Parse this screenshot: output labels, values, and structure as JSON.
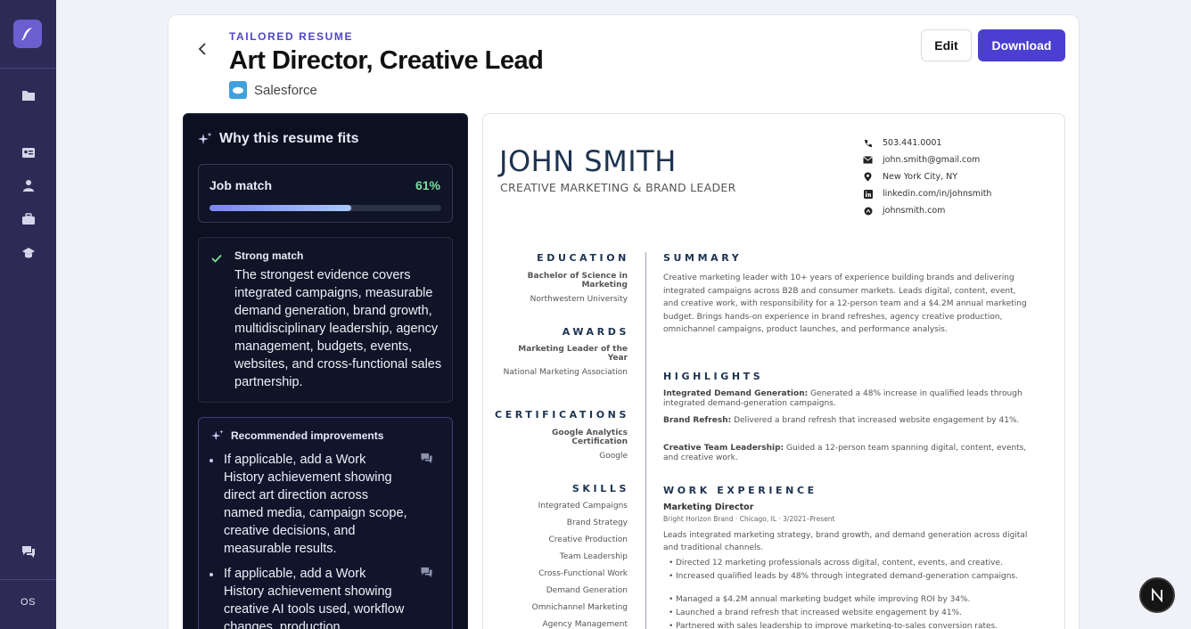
{
  "sidebar": {
    "footer_label": "OS"
  },
  "header": {
    "eyebrow": "TAILORED RESUME",
    "title": "Art Director, Creative Lead",
    "company": "Salesforce",
    "edit_label": "Edit",
    "download_label": "Download"
  },
  "fit": {
    "title": "Why this resume fits",
    "match_label": "Job match",
    "match_pct": "61%",
    "match_value": 0.61,
    "strong_head": "Strong match",
    "strong_body": "The strongest evidence covers integrated campaigns, measurable demand generation, brand growth, multidisciplinary leadership, agency management, budgets, events, websites, and cross-functional sales partnership.",
    "rec_head": "Recommended improvements",
    "recommendations": [
      "If applicable, add a Work History achievement showing direct art direction across named media, campaign scope, creative decisions, and measurable results.",
      "If applicable, add a Work History achievement showing creative AI tools used, workflow changes, production"
    ]
  },
  "resume": {
    "name": "JOHN SMITH",
    "role": "CREATIVE MARKETING & BRAND LEADER",
    "contact": {
      "phone": "503.441.0001",
      "email": "john.smith@gmail.com",
      "location": "New York City, NY",
      "linkedin": "linkedin.com/in/johnsmith",
      "website": "johnsmith.com"
    },
    "education_head": "EDUCATION",
    "degree": "Bachelor of Science in Marketing",
    "school": "Northwestern University",
    "awards_head": "AWARDS",
    "award": "Marketing Leader of the Year",
    "award_org": "National Marketing Association",
    "cert_head": "CERTIFICATIONS",
    "cert": "Google Analytics Certification",
    "cert_org": "Google",
    "skills_head": "SKILLS",
    "skills": [
      "Integrated Campaigns",
      "Brand Strategy",
      "Creative Production",
      "Team Leadership",
      "Cross-Functional Work",
      "Demand Generation",
      "Omnichannel Marketing",
      "Agency Management"
    ],
    "summary_head": "SUMMARY",
    "summary": "Creative marketing leader with 10+ years of experience building brands and delivering integrated campaigns across B2B and consumer markets. Leads digital, content, event, and creative work, with responsibility for a 12-person team and a $4.2M annual marketing budget. Brings hands-on experience in brand refreshes, agency creative production, omnichannel campaigns, product launches, and performance analysis.",
    "highlights_head": "HIGHLIGHTS",
    "highlights": [
      {
        "label": "Integrated Demand Generation:",
        "text": " Generated a 48% increase in qualified leads through integrated demand-generation campaigns."
      },
      {
        "label": "Brand Refresh:",
        "text": " Delivered a brand refresh that increased website engagement by 41%."
      },
      {
        "label": "Creative Team Leadership:",
        "text": " Guided a 12-person team spanning digital, content, events, and creative work."
      }
    ],
    "work_head": "WORK EXPERIENCE",
    "job_title": "Marketing Director",
    "job_meta": "Bright Horizon Brand · Chicago, IL · 3/2021–Present",
    "job_summary": "Leads integrated marketing strategy, brand growth, and demand generation across digital and traditional channels.",
    "job_bullets": [
      "Directed 12 marketing professionals across digital, content, events, and creative.",
      "Increased qualified leads by 48% through integrated demand-generation campaigns.",
      "Managed a $4.2M annual marketing budget while improving ROI by 34%.",
      "Launched a brand refresh that increased website engagement by 41%.",
      "Partnered with sales leadership to improve marketing-to-sales conversion rates."
    ]
  },
  "fab": {
    "label": "N"
  }
}
